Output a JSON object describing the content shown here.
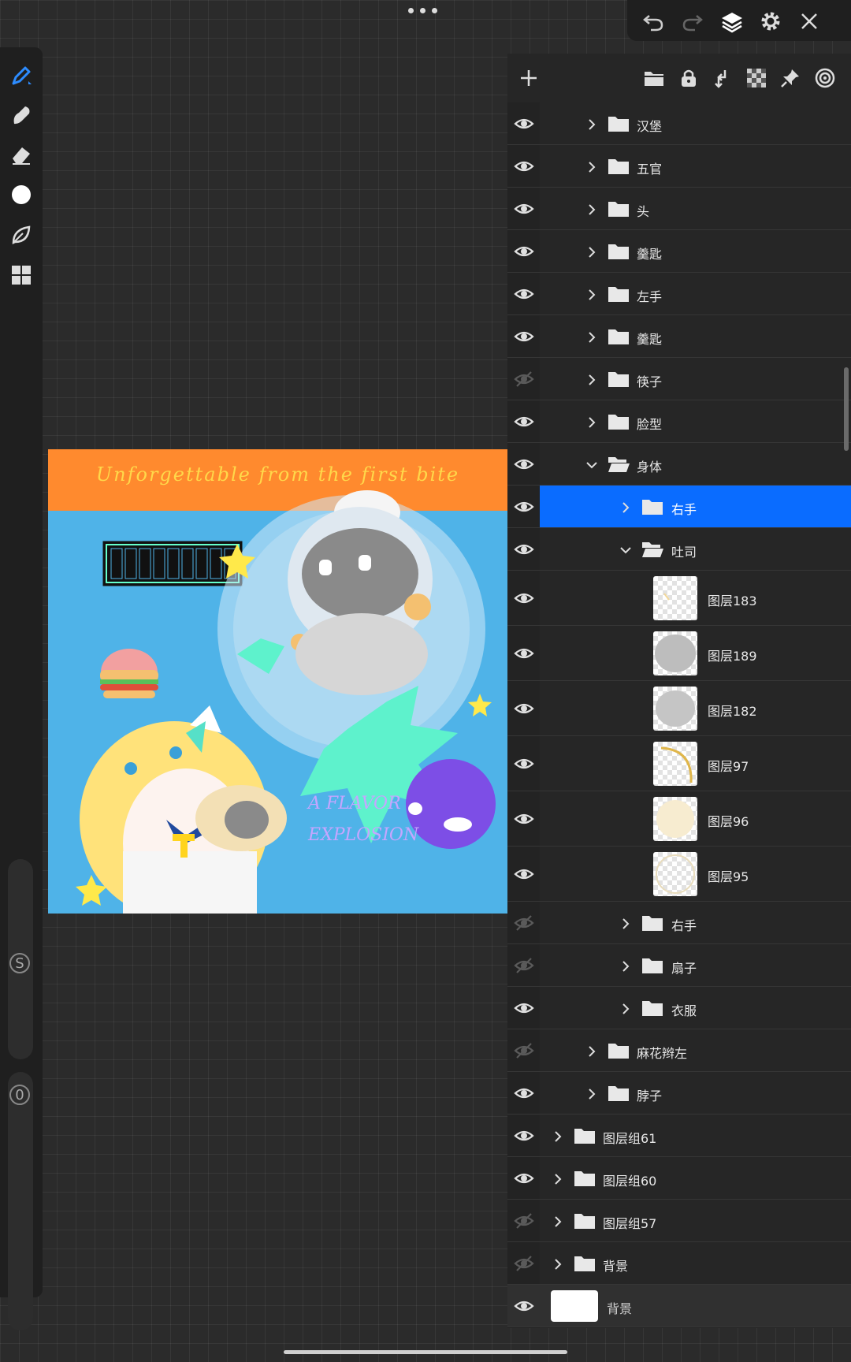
{
  "canvas": {
    "banner_text": "Unforgettable from the first bite",
    "handwriting": "A FLAVOR EXPLOSION",
    "colors": {
      "background": "#4fb3e8",
      "banner": "#ff8a2e",
      "banner_text": "#ffd84a"
    }
  },
  "left_toolbar": {
    "tools": [
      "brush-icon",
      "smudge-icon",
      "eraser-icon",
      "color-dot",
      "leaf-icon",
      "gallery-icon"
    ],
    "size_slider_label": "S",
    "opacity_slider_label": "0"
  },
  "top_toolbar": {
    "icons": [
      "undo-icon",
      "redo-icon",
      "layers-icon",
      "settings-icon",
      "close-icon"
    ]
  },
  "layers_panel": {
    "header_icons": [
      "add-icon",
      "folder-icon",
      "lock-icon",
      "merge-down-icon",
      "checkerboard-icon",
      "pin-icon",
      "target-icon"
    ],
    "rows": [
      {
        "type": "group",
        "name": "汉堡",
        "visible": true,
        "indent": 1,
        "expanded": false
      },
      {
        "type": "group",
        "name": "五官",
        "visible": true,
        "indent": 1,
        "expanded": false
      },
      {
        "type": "group",
        "name": "头",
        "visible": true,
        "indent": 1,
        "expanded": false
      },
      {
        "type": "group",
        "name": "羹匙",
        "visible": true,
        "indent": 1,
        "expanded": false
      },
      {
        "type": "group",
        "name": "左手",
        "visible": true,
        "indent": 1,
        "expanded": false
      },
      {
        "type": "group",
        "name": "羹匙",
        "visible": true,
        "indent": 1,
        "expanded": false
      },
      {
        "type": "group",
        "name": "筷子",
        "visible": false,
        "indent": 1,
        "expanded": false
      },
      {
        "type": "group",
        "name": "脸型",
        "visible": true,
        "indent": 1,
        "expanded": false
      },
      {
        "type": "group",
        "name": "身体",
        "visible": true,
        "indent": 1,
        "expanded": true
      },
      {
        "type": "group",
        "name": "右手",
        "visible": true,
        "indent": 2,
        "expanded": false,
        "selected": true
      },
      {
        "type": "group",
        "name": "吐司",
        "visible": true,
        "indent": 2,
        "expanded": true
      },
      {
        "type": "layer",
        "name": "图层183",
        "visible": true,
        "indent": 3
      },
      {
        "type": "layer",
        "name": "图层189",
        "visible": true,
        "indent": 3
      },
      {
        "type": "layer",
        "name": "图层182",
        "visible": true,
        "indent": 3
      },
      {
        "type": "layer",
        "name": "图层97",
        "visible": true,
        "indent": 3
      },
      {
        "type": "layer",
        "name": "图层96",
        "visible": true,
        "indent": 3
      },
      {
        "type": "layer",
        "name": "图层95",
        "visible": true,
        "indent": 3
      },
      {
        "type": "group",
        "name": "右手",
        "visible": false,
        "indent": 2,
        "expanded": false
      },
      {
        "type": "group",
        "name": "扇子",
        "visible": false,
        "indent": 2,
        "expanded": false
      },
      {
        "type": "group",
        "name": "衣服",
        "visible": true,
        "indent": 2,
        "expanded": false
      },
      {
        "type": "group",
        "name": "麻花辫左",
        "visible": false,
        "indent": 1,
        "expanded": false
      },
      {
        "type": "group",
        "name": "脖子",
        "visible": true,
        "indent": 1,
        "expanded": false
      },
      {
        "type": "group",
        "name": "图层组61",
        "visible": true,
        "indent": 0,
        "expanded": false
      },
      {
        "type": "group",
        "name": "图层组60",
        "visible": true,
        "indent": 0,
        "expanded": false
      },
      {
        "type": "group",
        "name": "图层组57",
        "visible": false,
        "indent": 0,
        "expanded": false
      },
      {
        "type": "group",
        "name": "背景",
        "visible": false,
        "indent": 0,
        "expanded": false
      },
      {
        "type": "background",
        "name": "背景",
        "visible": true,
        "indent": 0
      }
    ]
  },
  "colors": {
    "selection": "#0a6cff",
    "panel": "#262626",
    "accent_tool": "#2d8cff"
  }
}
